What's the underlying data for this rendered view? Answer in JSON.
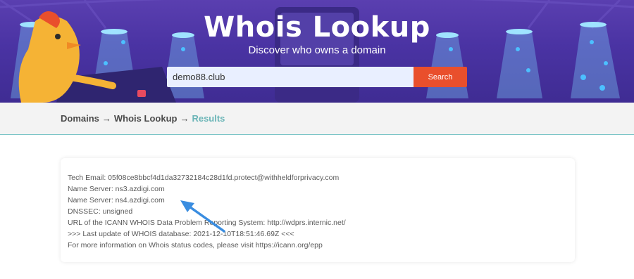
{
  "hero": {
    "title": "Whois Lookup",
    "subtitle": "Discover who owns a domain",
    "search_value": "demo88.club",
    "search_button": "Search"
  },
  "breadcrumb": {
    "items": [
      "Domains",
      "Whois Lookup",
      "Results"
    ],
    "separator": "→"
  },
  "result": {
    "lines": [
      "Tech Email: 05f08ce8bbcf4d1da32732184c28d1fd.protect@withheldforprivacy.com",
      "Name Server: ns3.azdigi.com",
      "Name Server: ns4.azdigi.com",
      "DNSSEC: unsigned",
      "URL of the ICANN WHOIS Data Problem Reporting System: http://wdprs.internic.net/",
      ">>> Last update of WHOIS database: 2021-12-10T18:51:46.69Z <<<",
      "For more information on Whois status codes, please visit https://icann.org/epp"
    ]
  },
  "colors": {
    "hero_bg": "#4a33a3",
    "search_button": "#e94f2c",
    "search_input_bg": "#e9efff",
    "breadcrumb_current": "#6bb5b7",
    "annotation_arrow": "#3a8de0"
  },
  "icons": {
    "mascot": "rooster-mascot-illustration",
    "annotation": "pointer-arrow-icon"
  }
}
